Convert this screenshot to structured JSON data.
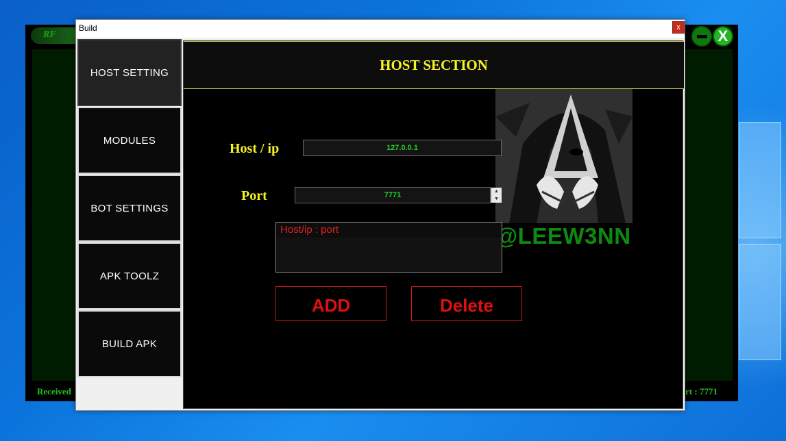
{
  "background_app": {
    "logo_text": "RF",
    "status_left": "Received",
    "status_right": "rt : 7771",
    "close_glyph": "X"
  },
  "dialog": {
    "title": "Build",
    "close_glyph": "x"
  },
  "sidebar": {
    "items": [
      {
        "label": "HOST SETTING",
        "active": true
      },
      {
        "label": "MODULES",
        "active": false
      },
      {
        "label": "BOT SETTINGS",
        "active": false
      },
      {
        "label": "APK TOOLZ",
        "active": false
      },
      {
        "label": "BUILD APK",
        "active": false
      }
    ]
  },
  "host_section": {
    "header": "HOST SECTION",
    "host_label": "Host / ip",
    "host_value": "127.0.0.1",
    "port_label": "Port",
    "port_value": "7771",
    "list_items": [
      "Host/ip : port"
    ],
    "add_label": "ADD",
    "delete_label": "Delete",
    "watermark": "@LEEW3NN"
  },
  "colors": {
    "accent_yellow": "#f5f522",
    "value_green": "#22d022",
    "danger_red": "#e01010",
    "watermark_green": "#0e8a0e"
  }
}
